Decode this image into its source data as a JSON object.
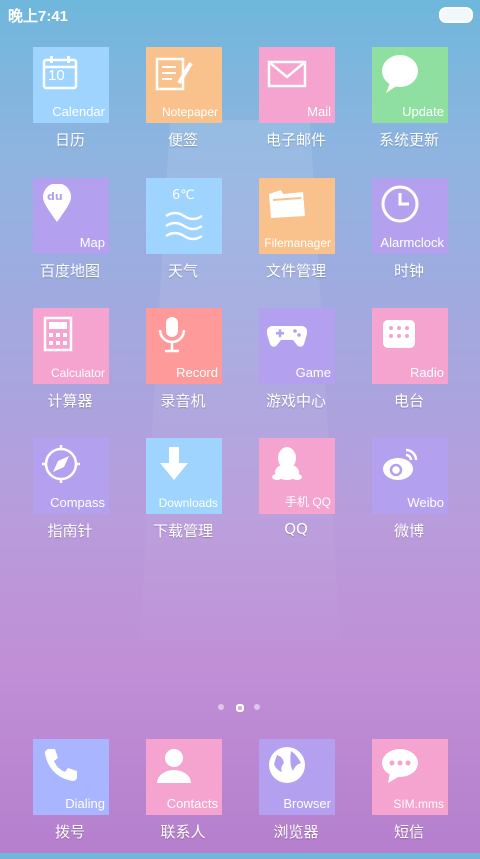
{
  "status_bar": {
    "time": "晚上7:41"
  },
  "apps": [
    {
      "name": "calendar",
      "en": "Calendar",
      "cn": "日历",
      "color": "#9fd4ff",
      "icon": "calendar-icon",
      "day": "10"
    },
    {
      "name": "notepaper",
      "en": "Notepaper",
      "cn": "便签",
      "color": "#f9c28d",
      "icon": "notepad-icon"
    },
    {
      "name": "mail",
      "en": "Mail",
      "cn": "电子邮件",
      "color": "#f5a3cf",
      "icon": "mail-icon"
    },
    {
      "name": "update",
      "en": "Update",
      "cn": "系统更新",
      "color": "#8fe0a0",
      "icon": "speech-bubble-icon"
    },
    {
      "name": "map",
      "en": "Map",
      "cn": "百度地图",
      "color": "#b3a1f0",
      "icon": "map-pin-icon",
      "badge": "du"
    },
    {
      "name": "weather",
      "en": "",
      "cn": "天气",
      "color": "#9fd4ff",
      "icon": "weather-waves-icon",
      "temp": "6℃"
    },
    {
      "name": "filemanager",
      "en": "Filemanager",
      "cn": "文件管理",
      "color": "#f9c28d",
      "icon": "folder-icon"
    },
    {
      "name": "alarmclock",
      "en": "Alarmclock",
      "cn": "时钟",
      "color": "#b3a1f0",
      "icon": "clock-icon"
    },
    {
      "name": "calculator",
      "en": "Calculator",
      "cn": "计算器",
      "color": "#f5a3cf",
      "icon": "calculator-icon"
    },
    {
      "name": "record",
      "en": "Record",
      "cn": "录音机",
      "color": "#ff9a9a",
      "icon": "microphone-icon"
    },
    {
      "name": "game",
      "en": "Game",
      "cn": "游戏中心",
      "color": "#b3a1f0",
      "icon": "gamepad-icon"
    },
    {
      "name": "radio",
      "en": "Radio",
      "cn": "电台",
      "color": "#f5a3cf",
      "icon": "radio-icon"
    },
    {
      "name": "compass",
      "en": "Compass",
      "cn": "指南针",
      "color": "#b3a1f0",
      "icon": "compass-icon"
    },
    {
      "name": "downloads",
      "en": "Downloads",
      "cn": "下载管理",
      "color": "#9fd4ff",
      "icon": "download-arrow-icon"
    },
    {
      "name": "qq",
      "en": "手机 QQ",
      "cn": "QQ",
      "color": "#f5a3cf",
      "icon": "qq-penguin-icon"
    },
    {
      "name": "weibo",
      "en": "Weibo",
      "cn": "微博",
      "color": "#b3a1f0",
      "icon": "weibo-icon"
    }
  ],
  "dock": [
    {
      "name": "dialing",
      "en": "Dialing",
      "cn": "拨号",
      "color": "#a9b5ff",
      "icon": "phone-icon"
    },
    {
      "name": "contacts",
      "en": "Contacts",
      "cn": "联系人",
      "color": "#f5a3cf",
      "icon": "contact-person-icon"
    },
    {
      "name": "browser",
      "en": "Browser",
      "cn": "浏览器",
      "color": "#b3a1f0",
      "icon": "globe-icon"
    },
    {
      "name": "sms",
      "en": "SIM.mms",
      "cn": "短信",
      "color": "#f5a3cf",
      "icon": "message-bubble-icon"
    }
  ],
  "page_indicator": {
    "pages": 3,
    "current": 2
  }
}
